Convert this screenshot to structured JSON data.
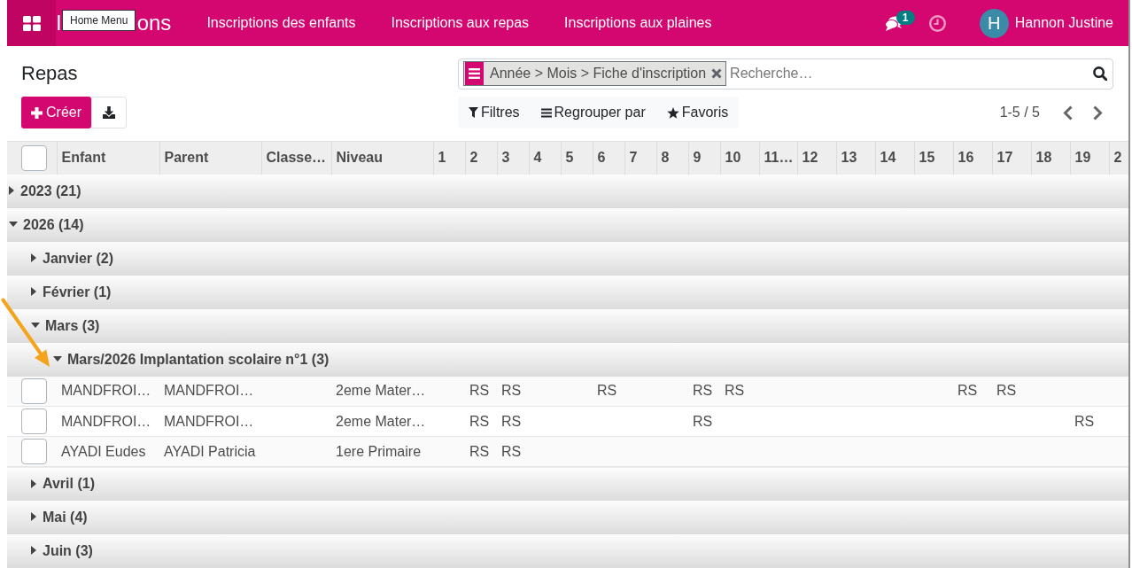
{
  "navbar": {
    "brand": [
      "I",
      "ons"
    ],
    "tooltip": "Home Menu",
    "menus": [
      "Inscriptions des enfants",
      "Inscriptions aux repas",
      "Inscriptions aux plaines"
    ],
    "messages_badge": "1",
    "user": {
      "initial": "H",
      "name": "Hannon Justine"
    }
  },
  "control_panel": {
    "title": "Repas",
    "create_label": "Créer",
    "search": {
      "facet": "Année > Mois > Fiche d'inscription",
      "placeholder": "Recherche…"
    },
    "options": [
      {
        "kind": "filter",
        "label": "Filtres"
      },
      {
        "kind": "group",
        "label": "Regrouper par"
      },
      {
        "kind": "favorite",
        "label": "Favoris"
      }
    ],
    "pager": "1-5 / 5"
  },
  "table": {
    "select_all": {
      "checked": false
    },
    "columns": [
      "Enfant",
      "Parent",
      "Classe…",
      "Niveau",
      "1",
      "2",
      "3",
      "4",
      "5",
      "6",
      "7",
      "8",
      "9",
      "10",
      "11…",
      "12",
      "13",
      "14",
      "15",
      "16",
      "17",
      "18",
      "19",
      "2"
    ],
    "groups": [
      {
        "label": "2023 (21)",
        "expanded": false
      },
      {
        "label": "2026 (14)",
        "expanded": true,
        "children": [
          {
            "label": "Janvier (2)",
            "expanded": false
          },
          {
            "label": "Février (1)",
            "expanded": false
          },
          {
            "label": "Mars (3)",
            "expanded": true,
            "children": [
              {
                "label": "Mars/2026 Implantation scolaire n°1 (3)",
                "expanded": true,
                "rows": [
                  {
                    "checked": false,
                    "cells": [
                      "MANDFROI…",
                      "MANDFROI…",
                      null,
                      "2eme Mater…",
                      null,
                      "RS",
                      "RS",
                      null,
                      null,
                      "RS",
                      null,
                      null,
                      "RS",
                      "RS",
                      null,
                      null,
                      null,
                      null,
                      null,
                      "RS",
                      "RS",
                      null,
                      null,
                      null
                    ]
                  },
                  {
                    "checked": false,
                    "cells": [
                      "MANDFROI…",
                      "MANDFROI…",
                      null,
                      "2eme Mater…",
                      null,
                      "RS",
                      "RS",
                      null,
                      null,
                      null,
                      null,
                      null,
                      "RS",
                      null,
                      null,
                      null,
                      null,
                      null,
                      null,
                      null,
                      null,
                      null,
                      "RS",
                      null
                    ]
                  },
                  {
                    "checked": false,
                    "cells": [
                      "AYADI Eudes",
                      "AYADI Patricia",
                      null,
                      "1ere Primaire",
                      null,
                      "RS",
                      "RS",
                      null,
                      null,
                      null,
                      null,
                      null,
                      null,
                      null,
                      null,
                      null,
                      null,
                      null,
                      null,
                      null,
                      null,
                      null,
                      null,
                      null
                    ]
                  }
                ]
              }
            ]
          },
          {
            "label": "Avril (1)",
            "expanded": false
          },
          {
            "label": "Mai (4)",
            "expanded": false
          },
          {
            "label": "Juin (3)",
            "expanded": false
          }
        ]
      }
    ]
  },
  "annotations": [
    {
      "kind": "arrow"
    }
  ]
}
